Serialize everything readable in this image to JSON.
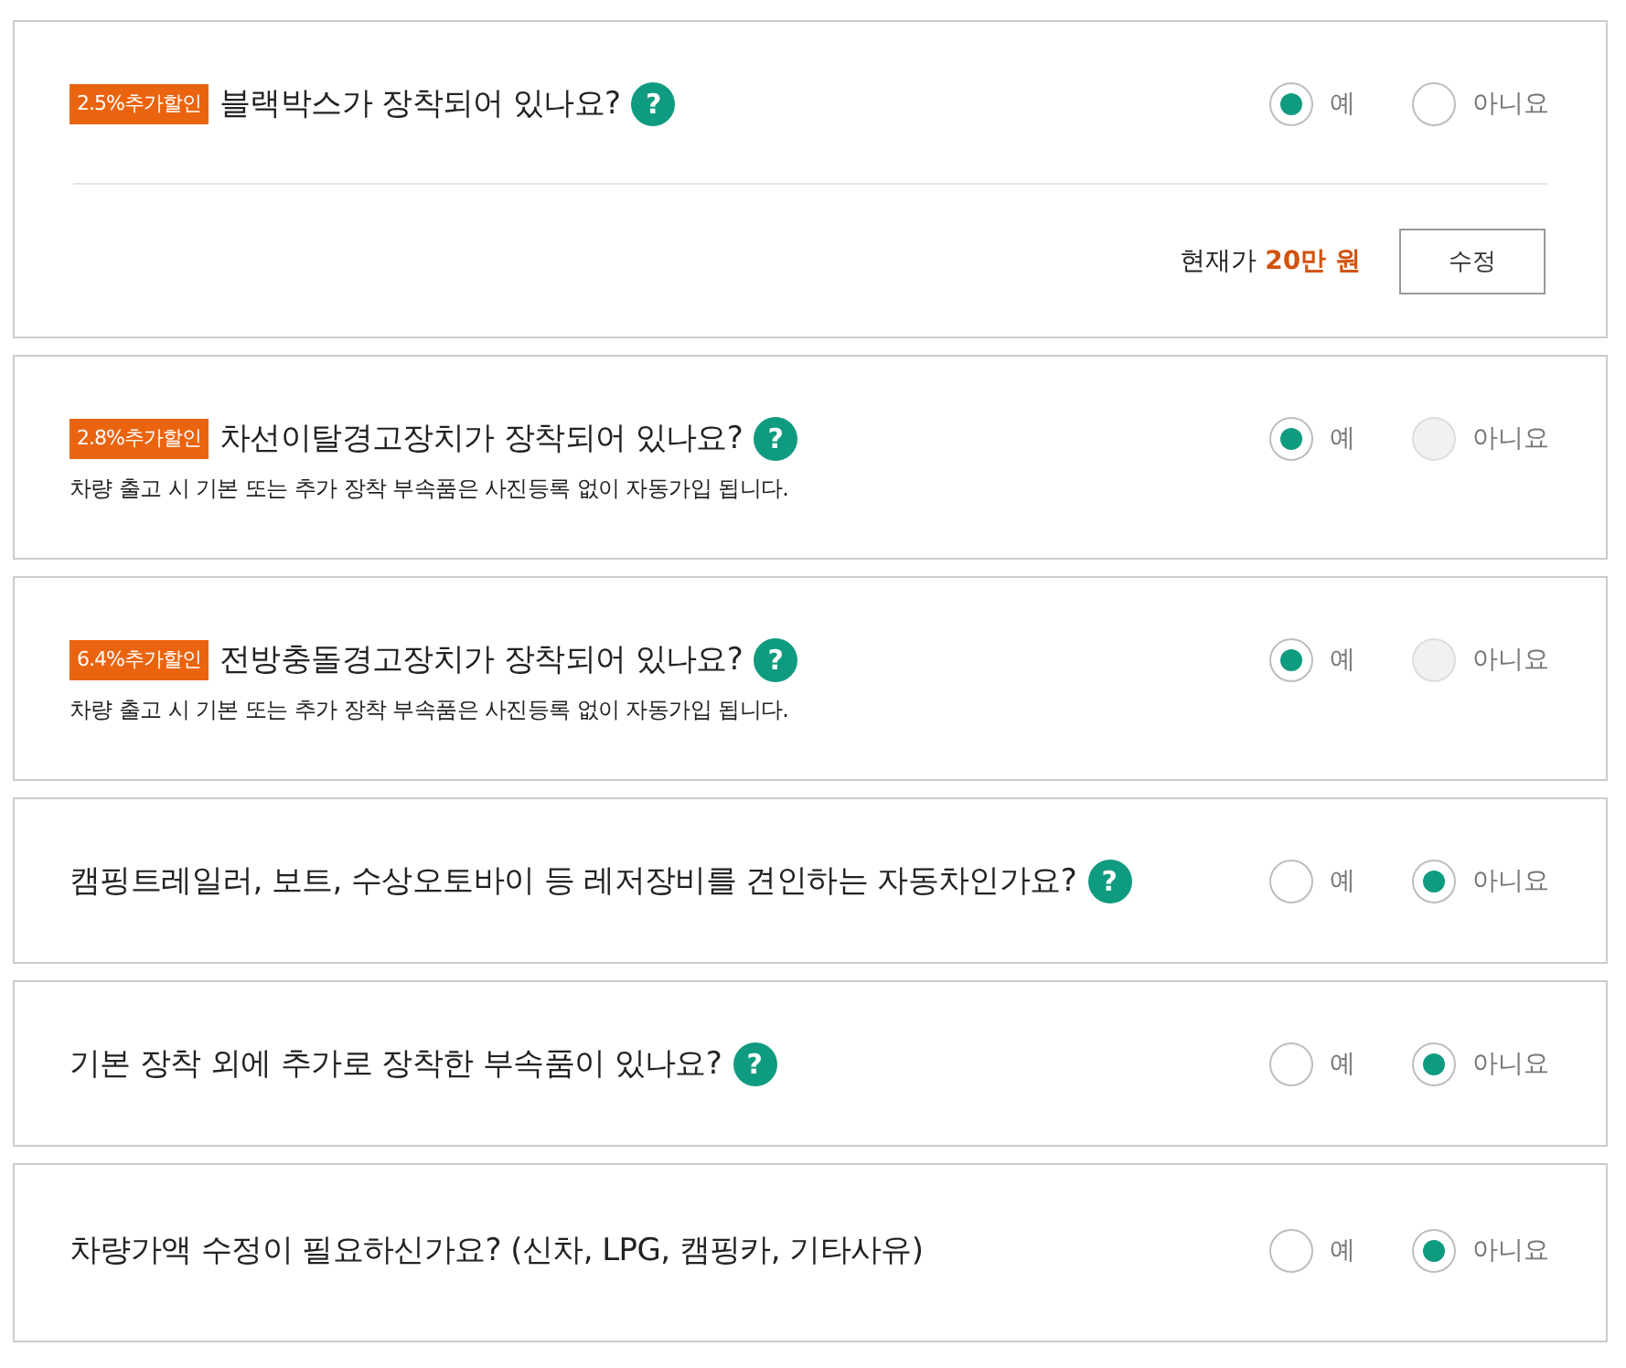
{
  "questions": [
    {
      "badge": "2.5%추가할인",
      "text": "블랙박스가 장착되어 있나요?",
      "help": "?",
      "options": [
        {
          "label": "예",
          "selected": true,
          "disabled": false
        },
        {
          "label": "아니요",
          "selected": false,
          "disabled": false
        }
      ],
      "price": "현재가 **20만 원**",
      "button": "수정"
    },
    {
      "badge": "2.8%추가할인",
      "text": "차선이탈경고장치가 장착되어 있나요?",
      "help": "?",
      "note": "차량 출고 시 기본 또는 추가 장착 부속품은 사진등록 없이 자동가입 됩니다.",
      "options": [
        {
          "label": "예",
          "selected": true,
          "disabled": false
        },
        {
          "label": "아니요",
          "selected": false,
          "disabled": true
        }
      ]
    },
    {
      "badge": "6.4%추가할인",
      "text": "전방충돌경고장치가 장착되어 있나요?",
      "help": "?",
      "note": "차량 출고 시 기본 또는 추가 장착 부속품은 사진등록 없이 자동가입 됩니다.",
      "options": [
        {
          "label": "예",
          "selected": true,
          "disabled": false
        },
        {
          "label": "아니요",
          "selected": false,
          "disabled": true
        }
      ]
    },
    {
      "text": "캠핑트레일러, 보트, 수상오토바이 등 레저장비를 견인하는 자동차인가요?",
      "help": "?",
      "options": [
        {
          "label": "예",
          "selected": false,
          "disabled": false
        },
        {
          "label": "아니요",
          "selected": true,
          "disabled": false
        }
      ]
    },
    {
      "text": "기본 장착 외에 추가로 장착한 부속품이 있나요?",
      "help": "?",
      "options": [
        {
          "label": "예",
          "selected": false,
          "disabled": false
        },
        {
          "label": "아니요",
          "selected": true,
          "disabled": false
        }
      ]
    },
    {
      "text": "차량가액 수정이 필요하신가요? (신차, LPG, 캠핑카, 기타사유)",
      "options": [
        {
          "label": "예",
          "selected": false,
          "disabled": false
        },
        {
          "label": "아니요",
          "selected": true,
          "disabled": false
        }
      ]
    }
  ]
}
